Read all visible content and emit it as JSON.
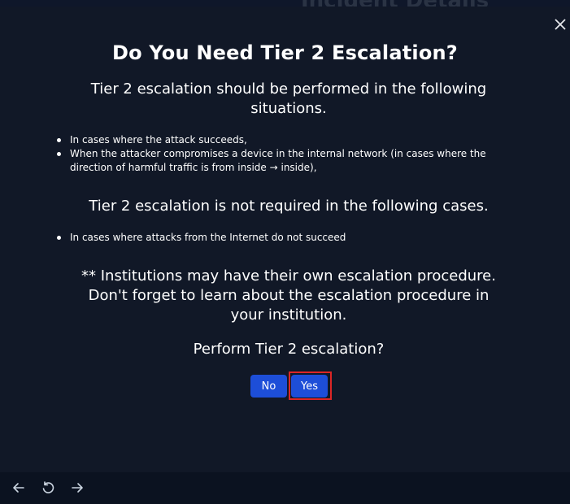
{
  "background": {
    "page_title": "Incident Details"
  },
  "modal": {
    "title": "Do You Need Tier 2 Escalation?",
    "intro": "Tier 2 escalation should be performed in the following situations.",
    "required_items": [
      "In cases where the attack succeeds,",
      "When the attacker compromises a device in the internal network (in cases where the direction of harmful traffic is from inside → inside),"
    ],
    "not_required_heading": "Tier 2 escalation is not required in the following cases.",
    "not_required_items": [
      "In cases where attacks from the Internet do not succeed"
    ],
    "note": "** Institutions may have their own escalation procedure. Don't forget to learn about the escalation procedure in your institution.",
    "question": "Perform Tier 2 escalation?",
    "buttons": {
      "no": "No",
      "yes": "Yes"
    }
  },
  "icons": {
    "close": "close-icon",
    "back": "arrow-left-icon",
    "reload": "reload-icon",
    "forward": "arrow-right-icon"
  },
  "colors": {
    "background": "#0f172a",
    "modal": "#111827",
    "button": "#1d4ed8",
    "highlight": "#dc2626"
  }
}
